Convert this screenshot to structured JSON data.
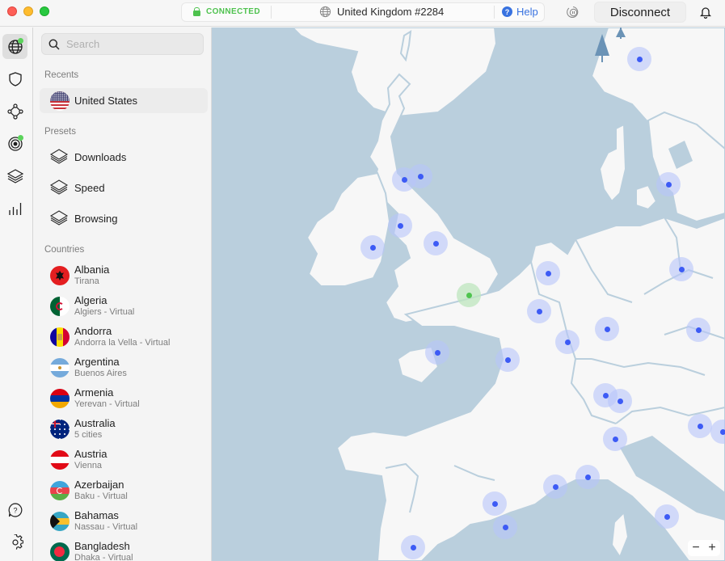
{
  "titlebar": {
    "status": "CONNECTED",
    "server": "United Kingdom #2284",
    "help": "Help",
    "disconnect": "Disconnect",
    "colors": {
      "connected": "#4ec24e",
      "help": "#3872e0"
    }
  },
  "rail": {
    "items": [
      {
        "name": "globe",
        "active": true,
        "badge": true
      },
      {
        "name": "shield",
        "active": false,
        "badge": false
      },
      {
        "name": "meshnet",
        "active": false,
        "badge": false
      },
      {
        "name": "radar",
        "active": false,
        "badge": true
      },
      {
        "name": "layers",
        "active": false,
        "badge": false
      },
      {
        "name": "stats",
        "active": false,
        "badge": false
      }
    ],
    "bottom": [
      {
        "name": "help"
      },
      {
        "name": "settings"
      }
    ]
  },
  "sidebar": {
    "search_placeholder": "Search",
    "recents_title": "Recents",
    "recents": [
      {
        "name": "United States",
        "flag": "us"
      }
    ],
    "presets_title": "Presets",
    "presets": [
      {
        "name": "Downloads"
      },
      {
        "name": "Speed"
      },
      {
        "name": "Browsing"
      }
    ],
    "countries_title": "Countries",
    "countries": [
      {
        "name": "Albania",
        "sub": "Tirana",
        "flag": "al"
      },
      {
        "name": "Algeria",
        "sub": "Algiers - Virtual",
        "flag": "dz"
      },
      {
        "name": "Andorra",
        "sub": "Andorra la Vella - Virtual",
        "flag": "ad"
      },
      {
        "name": "Argentina",
        "sub": "Buenos Aires",
        "flag": "ar"
      },
      {
        "name": "Armenia",
        "sub": "Yerevan - Virtual",
        "flag": "am"
      },
      {
        "name": "Australia",
        "sub": "5 cities",
        "flag": "au"
      },
      {
        "name": "Austria",
        "sub": "Vienna",
        "flag": "at"
      },
      {
        "name": "Azerbaijan",
        "sub": "Baku - Virtual",
        "flag": "az"
      },
      {
        "name": "Bahamas",
        "sub": "Nassau - Virtual",
        "flag": "bs"
      },
      {
        "name": "Bangladesh",
        "sub": "Dhaka - Virtual",
        "flag": "bd"
      }
    ]
  },
  "map": {
    "connected_location": "United Kingdom",
    "zoom_out": "−",
    "zoom_in": "+",
    "colors": {
      "sea": "#bacfdd",
      "land": "#f7f7f7",
      "pin": "#3d5bf5",
      "current_pin": "#4fc44f"
    }
  }
}
